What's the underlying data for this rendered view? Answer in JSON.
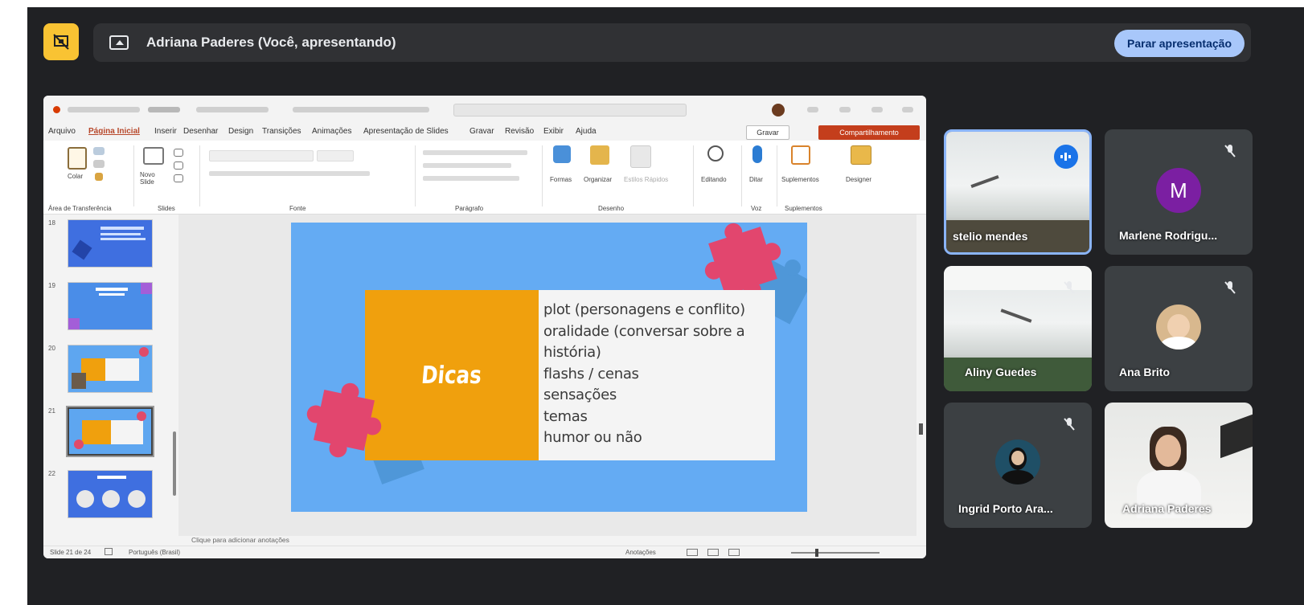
{
  "meet": {
    "presenting_text": "Adriana Paderes (Você, apresentando)",
    "stop_button": "Parar apresentação"
  },
  "ppt": {
    "menu": [
      "Arquivo",
      "Página Inicial",
      "Inserir",
      "Desenhar",
      "Design",
      "Transições",
      "Animações",
      "Apresentação de Slides",
      "Gravar",
      "Revisão",
      "Exibir",
      "Ajuda"
    ],
    "active_menu": "Página Inicial",
    "record_button": "Gravar",
    "share_button": "Compartilhamento",
    "ribbon": {
      "paste": "Colar",
      "new_slide": "Novo Slide",
      "shapes": "Formas",
      "arrange": "Organizar",
      "quick_styles": "Estilos Rápidos",
      "find": "Editando",
      "dictate": "Ditar",
      "addins": "Suplementos",
      "designer": "Designer",
      "group_clipboard": "Área de Transferência",
      "group_slides": "Slides",
      "group_font": "Fonte",
      "group_paragraph": "Parágrafo",
      "group_drawing": "Desenho",
      "group_voice": "Voz",
      "group_addins": "Suplementos"
    },
    "thumbnail_numbers": [
      "18",
      "19",
      "20",
      "21",
      "22"
    ],
    "selected_slide": "21",
    "slide": {
      "title": "Dicas",
      "tips": [
        "plot (personagens e conflito)",
        "oralidade (conversar sobre a",
        "história)",
        "flashs / cenas",
        "sensações",
        "temas",
        "humor ou não"
      ]
    },
    "notes_placeholder": "Clique para adicionar anotações",
    "status": {
      "slide_counter": "Slide 21 de 24",
      "language": "Português (Brasil)",
      "notes": "Anotações"
    }
  },
  "participants": [
    {
      "name": "stelio mendes",
      "speaking": true
    },
    {
      "name": "Marlene Rodrigu...",
      "initial": "M",
      "avatar_color": "#7b1fa2"
    },
    {
      "name": "Aliny Guedes"
    },
    {
      "name": "Ana Brito"
    },
    {
      "name": "Ingrid Porto Ara..."
    },
    {
      "name": "Adriana Paderes"
    }
  ],
  "colors": {
    "meet_bg": "#202124",
    "accent_yellow": "#f9c333",
    "stop_button_bg": "#a8c7fa",
    "slide_bg": "#64abf3",
    "title_box": "#f0a00d",
    "ppt_share": "#c43e1c"
  }
}
